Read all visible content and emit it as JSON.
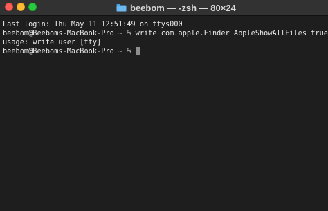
{
  "window": {
    "title": "beebom — -zsh — 80×24",
    "folder_icon": "folder-icon",
    "traffic_lights": {
      "close_color": "#ff5f57",
      "minimize_color": "#febc2e",
      "zoom_color": "#28c840"
    }
  },
  "terminal": {
    "lines": [
      "Last login: Thu May 11 12:51:49 on ttys000",
      "beebom@Beeboms-MacBook-Pro ~ % write com.apple.Finder AppleShowAllFiles true",
      "usage: write user [tty]"
    ],
    "prompt": "beebom@Beeboms-MacBook-Pro ~ % ",
    "background_color": "#1e1e1e",
    "text_color": "#e8e8e8"
  }
}
